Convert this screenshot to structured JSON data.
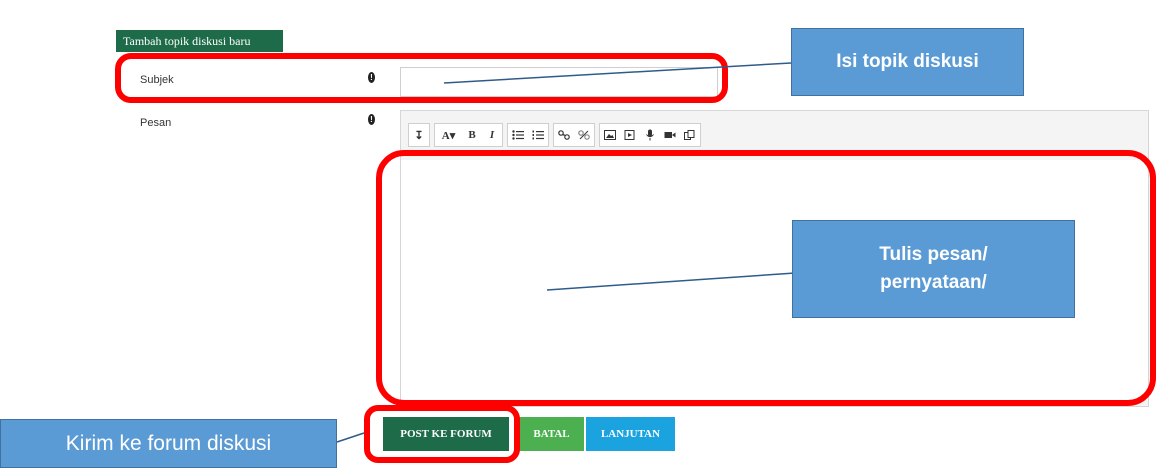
{
  "form": {
    "section_tab": "Tambah topik diskusi baru",
    "subject_label": "Subjek",
    "message_label": "Pesan",
    "required_icon": "!",
    "subject_value": ""
  },
  "toolbar": {
    "groups": [
      [
        "collapse-icon"
      ],
      [
        "font-style-icon",
        "bold-icon",
        "italic-icon"
      ],
      [
        "bullet-list-icon",
        "numbered-list-icon"
      ],
      [
        "link-icon",
        "unlink-icon"
      ],
      [
        "image-icon",
        "media-icon",
        "record-audio-icon",
        "record-video-icon",
        "manage-files-icon"
      ]
    ],
    "collapse_glyph": "↧",
    "font_glyph": "A▾",
    "bold_glyph": "B",
    "italic_glyph": "I"
  },
  "buttons": {
    "post": "POST KE FORUM",
    "cancel": "BATAL",
    "advanced": "LANJUTAN"
  },
  "annotations": {
    "subject_callout": "Isi topik diskusi",
    "message_callout_line1": "Tulis pesan/",
    "message_callout_line2": "pernyataan/",
    "post_callout": "Kirim ke forum diskusi"
  },
  "colors": {
    "brand_green": "#1e6b4a",
    "cancel_green": "#4caf50",
    "advanced_blue": "#1ba3e0",
    "highlight_red": "#ff0000",
    "callout_blue": "#5b9bd5"
  }
}
